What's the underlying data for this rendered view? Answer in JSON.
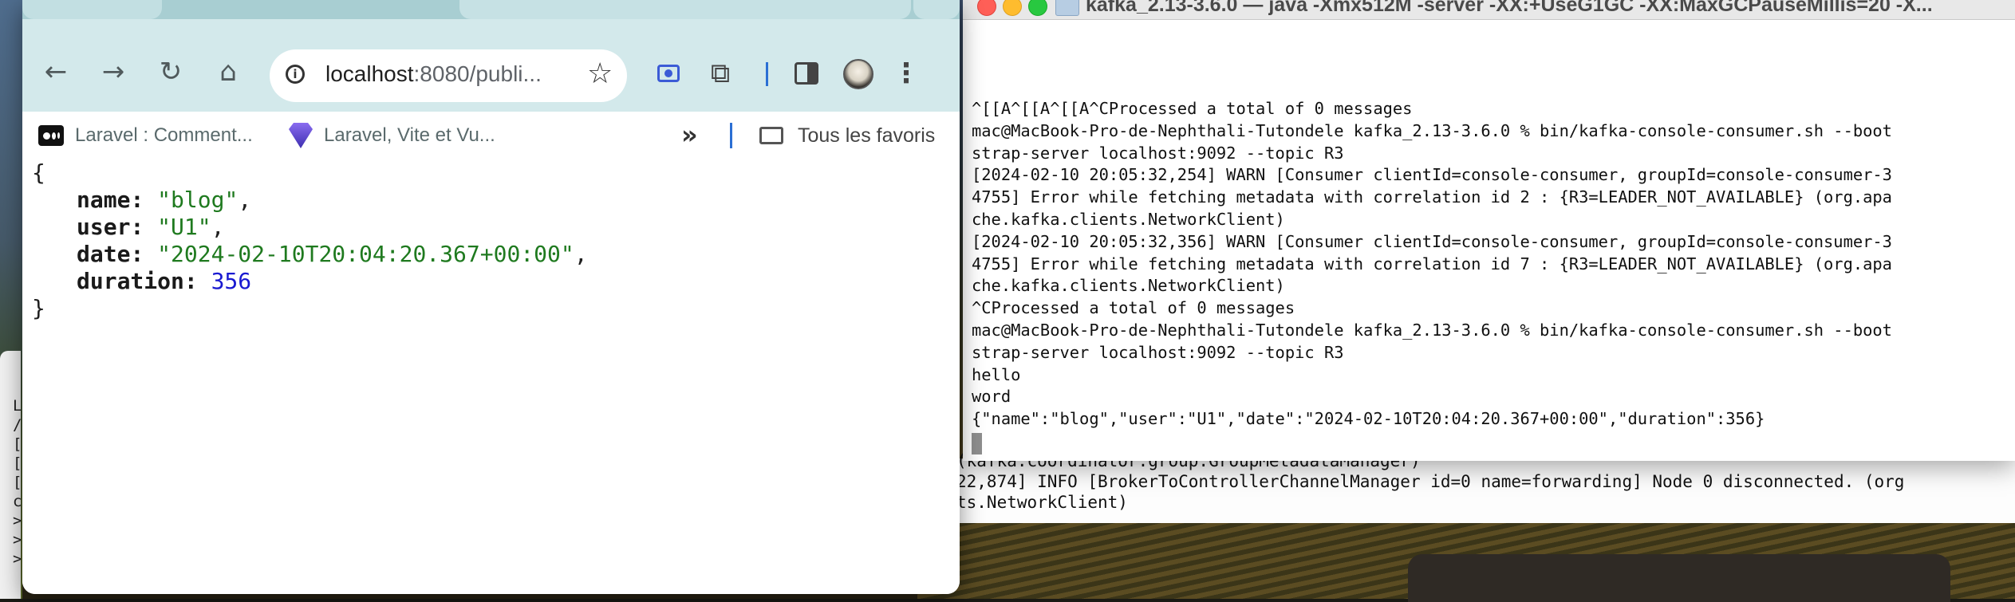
{
  "terminal": {
    "title": "kafka_2.13-3.6.0 — java -Xmx512M -server -XX:+UseG1GC -XX:MaxGCPauseMillis=20 -X...",
    "lines": [
      "^[[A^[[A^[[A^CProcessed a total of 0 messages",
      "mac@MacBook-Pro-de-Nephthali-Tutondele kafka_2.13-3.6.0 % bin/kafka-console-consumer.sh --boot",
      "strap-server localhost:9092 --topic R3",
      "[2024-02-10 20:05:32,254] WARN [Consumer clientId=console-consumer, groupId=console-consumer-3",
      "4755] Error while fetching metadata with correlation id 2 : {R3=LEADER_NOT_AVAILABLE} (org.apa",
      "che.kafka.clients.NetworkClient)",
      "[2024-02-10 20:05:32,356] WARN [Consumer clientId=console-consumer, groupId=console-consumer-3",
      "4755] Error while fetching metadata with correlation id 7 : {R3=LEADER_NOT_AVAILABLE} (org.apa",
      "che.kafka.clients.NetworkClient)",
      "^CProcessed a total of 0 messages",
      "mac@MacBook-Pro-de-Nephthali-Tutondele kafka_2.13-3.6.0 % bin/kafka-console-consumer.sh --boot",
      "strap-server localhost:9092 --topic R3",
      "hello",
      "word",
      "{\"name\":\"blog\",\"user\":\"U1\",\"date\":\"2024-02-10T20:04:20.367+00:00\",\"duration\":356}"
    ]
  },
  "background_terminal": {
    "lines": [
      "(kafka.coordinator.group.GroupMetadataManager)",
      "22,874] INFO [BrokerToControllerChannelManager id=0 name=forwarding] Node 0 disconnected. (org",
      "ts.NetworkClient)"
    ]
  },
  "background_left_terminal": {
    "lines": [
      "L",
      "/",
      "[m",
      "[m",
      "[m",
      "c",
      ">",
      ">",
      ">"
    ]
  },
  "chrome": {
    "url_host": "localhost",
    "url_rest": ":8080/publi...",
    "bookmarks": [
      {
        "label": "Laravel : Comment...",
        "icon": "medium-icon"
      },
      {
        "label": "Laravel, Vite et Vu...",
        "icon": "vite-icon"
      }
    ],
    "all_bookmarks_label": "Tous les favoris",
    "icons": {
      "back": "←",
      "forward": "→",
      "reload": "↻",
      "home": "⌂",
      "star": "☆",
      "more": "»",
      "menu": "⋮",
      "extensions": "⧉",
      "info": "i"
    }
  },
  "json_view": {
    "open_brace": "{",
    "close_brace": "}",
    "fields": [
      {
        "key": "name",
        "value": "\"blog\"",
        "type": "string",
        "comma": ","
      },
      {
        "key": "user",
        "value": "\"U1\"",
        "type": "string",
        "comma": ","
      },
      {
        "key": "date",
        "value": "\"2024-02-10T20:04:20.367+00:00\"",
        "type": "string",
        "comma": ","
      },
      {
        "key": "duration",
        "value": "356",
        "type": "number",
        "comma": ""
      }
    ]
  },
  "colors": {
    "json_string": "#1f7a1f",
    "json_number": "#1a1ad1",
    "chrome_toolbar": "#d3e9eb",
    "close_button": "#ff5f57",
    "minimize_button": "#febc2e",
    "maximize_button": "#28c840"
  }
}
